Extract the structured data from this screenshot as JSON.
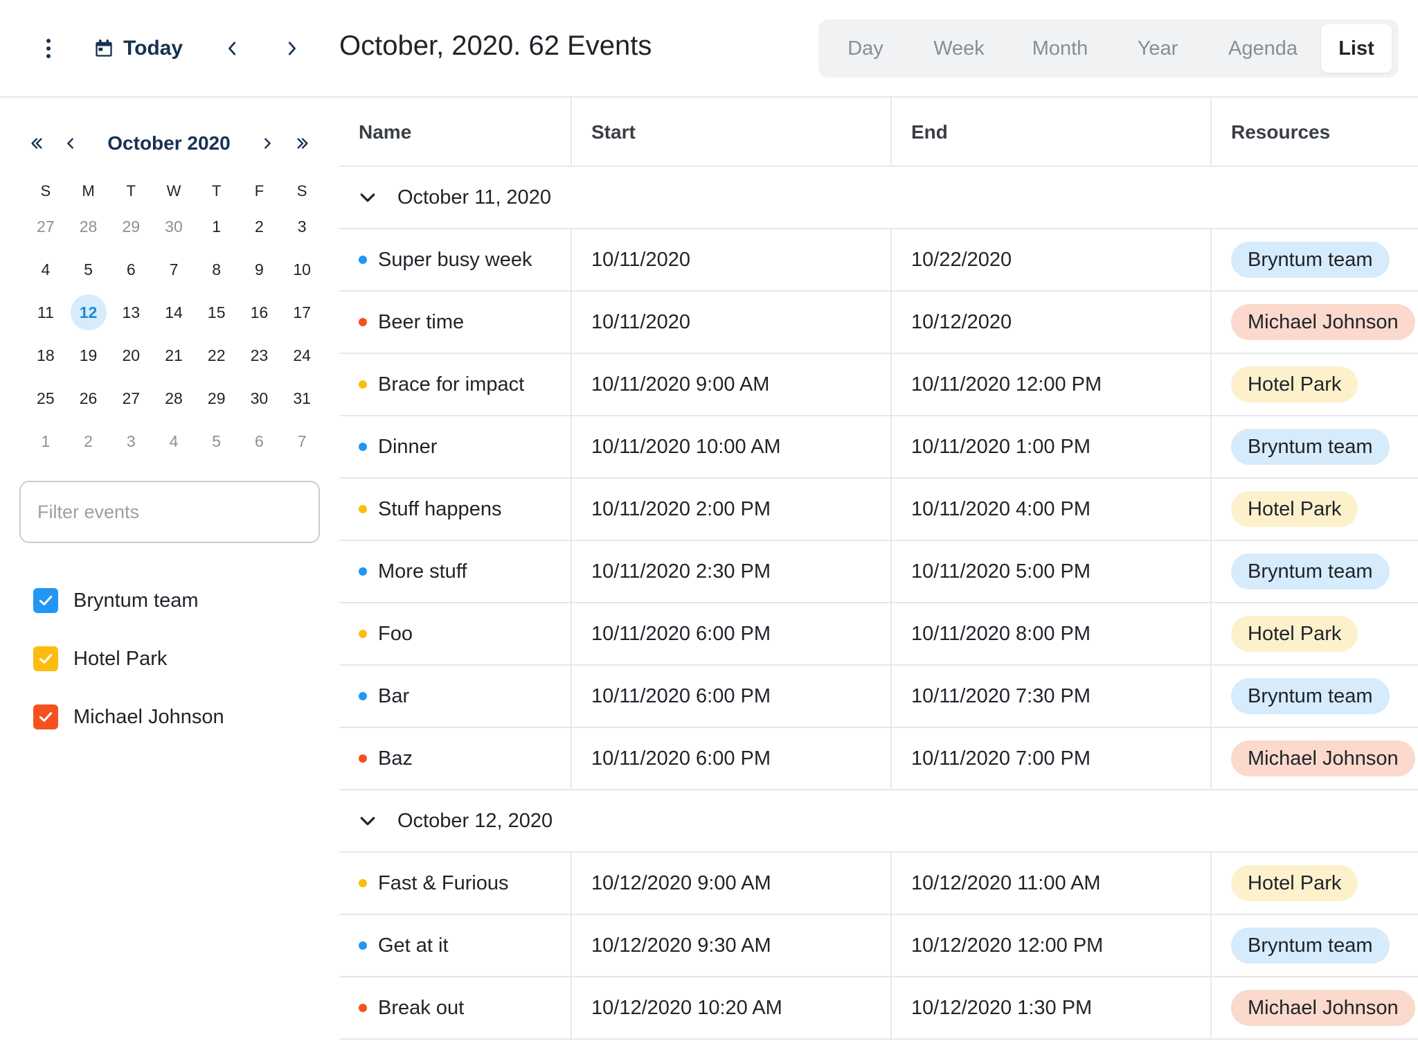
{
  "colors": {
    "bryntum": "#2196f3",
    "hotel": "#fdbd10",
    "michael": "#f4511e",
    "chip_bryntum": "#d6ebfb",
    "chip_hotel": "#fdf1cc",
    "chip_michael": "#fbd9cd",
    "today_bg": "#d6ecfb"
  },
  "toolbar": {
    "menu_icon": "more-vertical-icon",
    "today_icon": "calendar-icon",
    "today_label": "Today",
    "prev_icon": "chevron-left-icon",
    "next_icon": "chevron-right-icon",
    "title": "October, 2020. 62 Events",
    "views": [
      {
        "label": "Day",
        "active": false
      },
      {
        "label": "Week",
        "active": false
      },
      {
        "label": "Month",
        "active": false
      },
      {
        "label": "Year",
        "active": false
      },
      {
        "label": "Agenda",
        "active": false
      },
      {
        "label": "List",
        "active": true
      }
    ]
  },
  "sidebar": {
    "calendar": {
      "month_label": "October 2020",
      "days_of_week": [
        "S",
        "M",
        "T",
        "W",
        "T",
        "F",
        "S"
      ],
      "weeks": [
        [
          {
            "d": "27",
            "o": true
          },
          {
            "d": "28",
            "o": true
          },
          {
            "d": "29",
            "o": true
          },
          {
            "d": "30",
            "o": true
          },
          {
            "d": "1"
          },
          {
            "d": "2"
          },
          {
            "d": "3"
          }
        ],
        [
          {
            "d": "4"
          },
          {
            "d": "5"
          },
          {
            "d": "6"
          },
          {
            "d": "7"
          },
          {
            "d": "8"
          },
          {
            "d": "9"
          },
          {
            "d": "10"
          }
        ],
        [
          {
            "d": "11"
          },
          {
            "d": "12",
            "today": true
          },
          {
            "d": "13"
          },
          {
            "d": "14"
          },
          {
            "d": "15"
          },
          {
            "d": "16"
          },
          {
            "d": "17"
          }
        ],
        [
          {
            "d": "18"
          },
          {
            "d": "19"
          },
          {
            "d": "20"
          },
          {
            "d": "21"
          },
          {
            "d": "22"
          },
          {
            "d": "23"
          },
          {
            "d": "24"
          }
        ],
        [
          {
            "d": "25"
          },
          {
            "d": "26"
          },
          {
            "d": "27"
          },
          {
            "d": "28"
          },
          {
            "d": "29"
          },
          {
            "d": "30"
          },
          {
            "d": "31"
          }
        ],
        [
          {
            "d": "1",
            "o": true
          },
          {
            "d": "2",
            "o": true
          },
          {
            "d": "3",
            "o": true
          },
          {
            "d": "4",
            "o": true
          },
          {
            "d": "5",
            "o": true
          },
          {
            "d": "6",
            "o": true
          },
          {
            "d": "7",
            "o": true
          }
        ]
      ]
    },
    "filter": {
      "placeholder": "Filter events",
      "value": ""
    },
    "resources": [
      {
        "label": "Bryntum team",
        "color": "#2196f3",
        "checked": true
      },
      {
        "label": "Hotel Park",
        "color": "#fdbd10",
        "checked": true
      },
      {
        "label": "Michael Johnson",
        "color": "#f4511e",
        "checked": true
      }
    ]
  },
  "grid": {
    "columns": {
      "name": "Name",
      "start": "Start",
      "end": "End",
      "resources": "Resources"
    },
    "groups": [
      {
        "title": "October 11, 2020",
        "events": [
          {
            "name": "Super busy week",
            "start": "10/11/2020",
            "end": "10/22/2020",
            "resource": "Bryntum team",
            "res": "bryntum"
          },
          {
            "name": "Beer time",
            "start": "10/11/2020",
            "end": "10/12/2020",
            "resource": "Michael Johnson",
            "res": "michael"
          },
          {
            "name": "Brace for impact",
            "start": "10/11/2020 9:00 AM",
            "end": "10/11/2020 12:00 PM",
            "resource": "Hotel Park",
            "res": "hotel"
          },
          {
            "name": "Dinner",
            "start": "10/11/2020 10:00 AM",
            "end": "10/11/2020 1:00 PM",
            "resource": "Bryntum team",
            "res": "bryntum"
          },
          {
            "name": "Stuff happens",
            "start": "10/11/2020 2:00 PM",
            "end": "10/11/2020 4:00 PM",
            "resource": "Hotel Park",
            "res": "hotel"
          },
          {
            "name": "More stuff",
            "start": "10/11/2020 2:30 PM",
            "end": "10/11/2020 5:00 PM",
            "resource": "Bryntum team",
            "res": "bryntum"
          },
          {
            "name": "Foo",
            "start": "10/11/2020 6:00 PM",
            "end": "10/11/2020 8:00 PM",
            "resource": "Hotel Park",
            "res": "hotel"
          },
          {
            "name": "Bar",
            "start": "10/11/2020 6:00 PM",
            "end": "10/11/2020 7:30 PM",
            "resource": "Bryntum team",
            "res": "bryntum"
          },
          {
            "name": "Baz",
            "start": "10/11/2020 6:00 PM",
            "end": "10/11/2020 7:00 PM",
            "resource": "Michael Johnson",
            "res": "michael"
          }
        ]
      },
      {
        "title": "October 12, 2020",
        "events": [
          {
            "name": "Fast & Furious",
            "start": "10/12/2020 9:00 AM",
            "end": "10/12/2020 11:00 AM",
            "resource": "Hotel Park",
            "res": "hotel"
          },
          {
            "name": "Get at it",
            "start": "10/12/2020 9:30 AM",
            "end": "10/12/2020 12:00 PM",
            "resource": "Bryntum team",
            "res": "bryntum"
          },
          {
            "name": "Break out",
            "start": "10/12/2020 10:20 AM",
            "end": "10/12/2020 1:30 PM",
            "resource": "Michael Johnson",
            "res": "michael"
          }
        ]
      }
    ]
  }
}
